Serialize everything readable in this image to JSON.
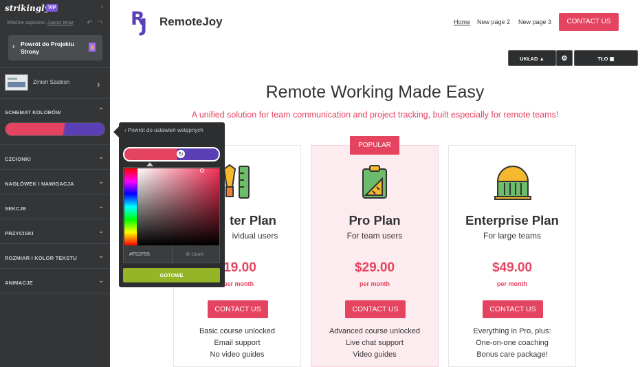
{
  "editor": {
    "brand": "strikingly",
    "badge": "VIP",
    "saved_text": "Właśnie zapisano.",
    "save_now": "Zapisz teraz",
    "back_button": "Powrót do Projektu Strony",
    "template_label": "Zmień Szablon",
    "sections": [
      {
        "label": "SCHEMAT KOLORÓW"
      },
      {
        "label": "CZCIONKI"
      },
      {
        "label": "NAGŁÓWEK I NAWIGACJA"
      },
      {
        "label": "SEKCJE"
      },
      {
        "label": "PRZYCISKI"
      },
      {
        "label": "ROZMIAR I KOLOR TEKSTU"
      },
      {
        "label": "ANIMACJE"
      }
    ],
    "palette_colors": [
      "#e54460",
      "#5b3fb7"
    ]
  },
  "color_picker": {
    "back_label": "Powrót do ustawień wstępnych",
    "hex_value": "#F52F55",
    "delete_label": "Usuń",
    "done_label": "GOTOWE"
  },
  "site": {
    "name": "RemoteJoy",
    "logo_letters": {
      "first": "R",
      "second": "J"
    },
    "nav": [
      {
        "label": "Home"
      },
      {
        "label": "New page 2"
      },
      {
        "label": "New page 3"
      }
    ],
    "contact_button": "CONTACT US",
    "editor_buttons": {
      "layout": "UKŁAD",
      "background": "TŁO"
    },
    "hero": {
      "title": "Remote Working Made Easy",
      "subtitle": "A unified solution for team communication and project tracking, built especially for remote teams!"
    },
    "popular_badge": "POPULAR",
    "plans": [
      {
        "name": "Starter Plan",
        "name_visible": "ter Plan",
        "for": "For individual users",
        "for_visible": "ividual users",
        "price": "$19.00",
        "price_visible": "19.00",
        "period": "per month",
        "period_visible": "per month",
        "button": "CONTACT US",
        "features": [
          "Basic course unlocked",
          "Email support",
          "No video guides"
        ]
      },
      {
        "name": "Pro Plan",
        "for": "For team users",
        "price": "$29.00",
        "period": "per month",
        "button": "CONTACT US",
        "features": [
          "Advanced course unlocked",
          "Live chat support",
          "Video guides"
        ]
      },
      {
        "name": "Enterprise Plan",
        "for": "For large teams",
        "price": "$49.00",
        "period": "per month",
        "button": "CONTACT US",
        "features": [
          "Everything in Pro, plus:",
          "One-on-one coaching",
          "Bonus care package!"
        ]
      }
    ],
    "colors": {
      "accent": "#e54460",
      "brand": "#5b3fb7",
      "pro_card_bg": "#fdecef"
    }
  }
}
